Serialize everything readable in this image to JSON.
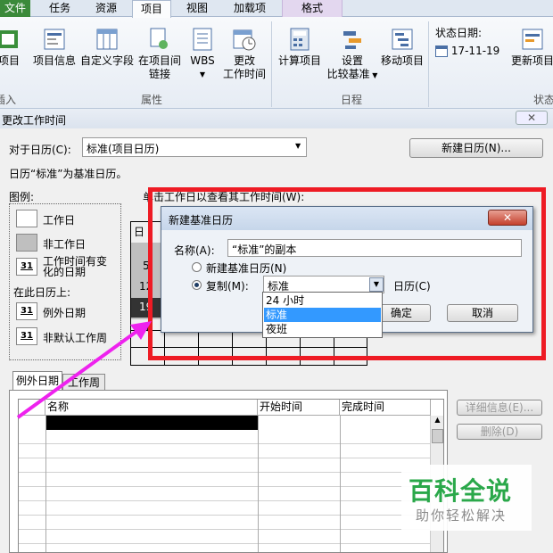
{
  "ribbon": {
    "tabs": [
      "文件",
      "任务",
      "资源",
      "项目",
      "视图",
      "加载项",
      "格式"
    ],
    "buttons": {
      "project_partial": "项目",
      "project_info": "项目信息",
      "custom_fields": "自定义字段",
      "links_line1": "在项目间",
      "links_line2": "链接",
      "wbs": "WBS",
      "change_time_line1": "更改",
      "change_time_line2": "工作时间",
      "calc_project": "计算项目",
      "set_baseline_line1": "设置",
      "set_baseline_line2": "比较基准",
      "move_project": "移动项目",
      "update_project": "更新项目"
    },
    "status_date_label": "状态日期:",
    "status_date_value": "17-11-19",
    "groups": {
      "insert_partial": "插入",
      "properties": "属性",
      "schedule": "日程",
      "status_partial": "状态"
    }
  },
  "dialog": {
    "title": "更改工作时间",
    "for_calendar_label": "对于日历(C):",
    "calendar_value": "标准(项目日历)",
    "new_calendar_button": "新建日历(N)...",
    "base_note": "日历“标准”为基准日历。",
    "legend_title": "图例:",
    "legend": {
      "working": "工作日",
      "nonworking": "非工作日",
      "edited_line1": "工作时间有变",
      "edited_line2": "化的日期",
      "on_this_calendar": "在此日历上:",
      "exception_day": "例外日期",
      "nondefault_week": "非默认工作周",
      "day_num": "31"
    },
    "click_hint": "单击工作日以查看其工作时间(W):",
    "calendar_visible": {
      "head": "日",
      "r1": "5",
      "r2": "12",
      "r3": "19",
      "r4": "26"
    },
    "tabs": [
      "例外日期",
      "工作周"
    ],
    "table_headers": [
      "名称",
      "开始时间",
      "完成时间"
    ],
    "details_button": "详细信息(E)...",
    "delete_button": "删除(D)"
  },
  "new_base_dialog": {
    "title": "新建基准日历",
    "name_label": "名称(A):",
    "name_value": "“标准”的副本",
    "radio_new": "新建基准日历(N)",
    "radio_copy": "复制(M):",
    "copy_value": "标准",
    "calendar_suffix": "日历(C)",
    "ok": "确定",
    "cancel": "取消",
    "dropdown_options": [
      "24 小时",
      "标准",
      "夜班"
    ],
    "selected_option": "标准"
  },
  "watermark": {
    "title": "百科全说",
    "subtitle": "助你轻松解决"
  },
  "colors": {
    "highlight": "#ee1b24",
    "arrow": "#ee22ee",
    "selection": "#3399ff",
    "file_tab": "#3b8a3a"
  }
}
